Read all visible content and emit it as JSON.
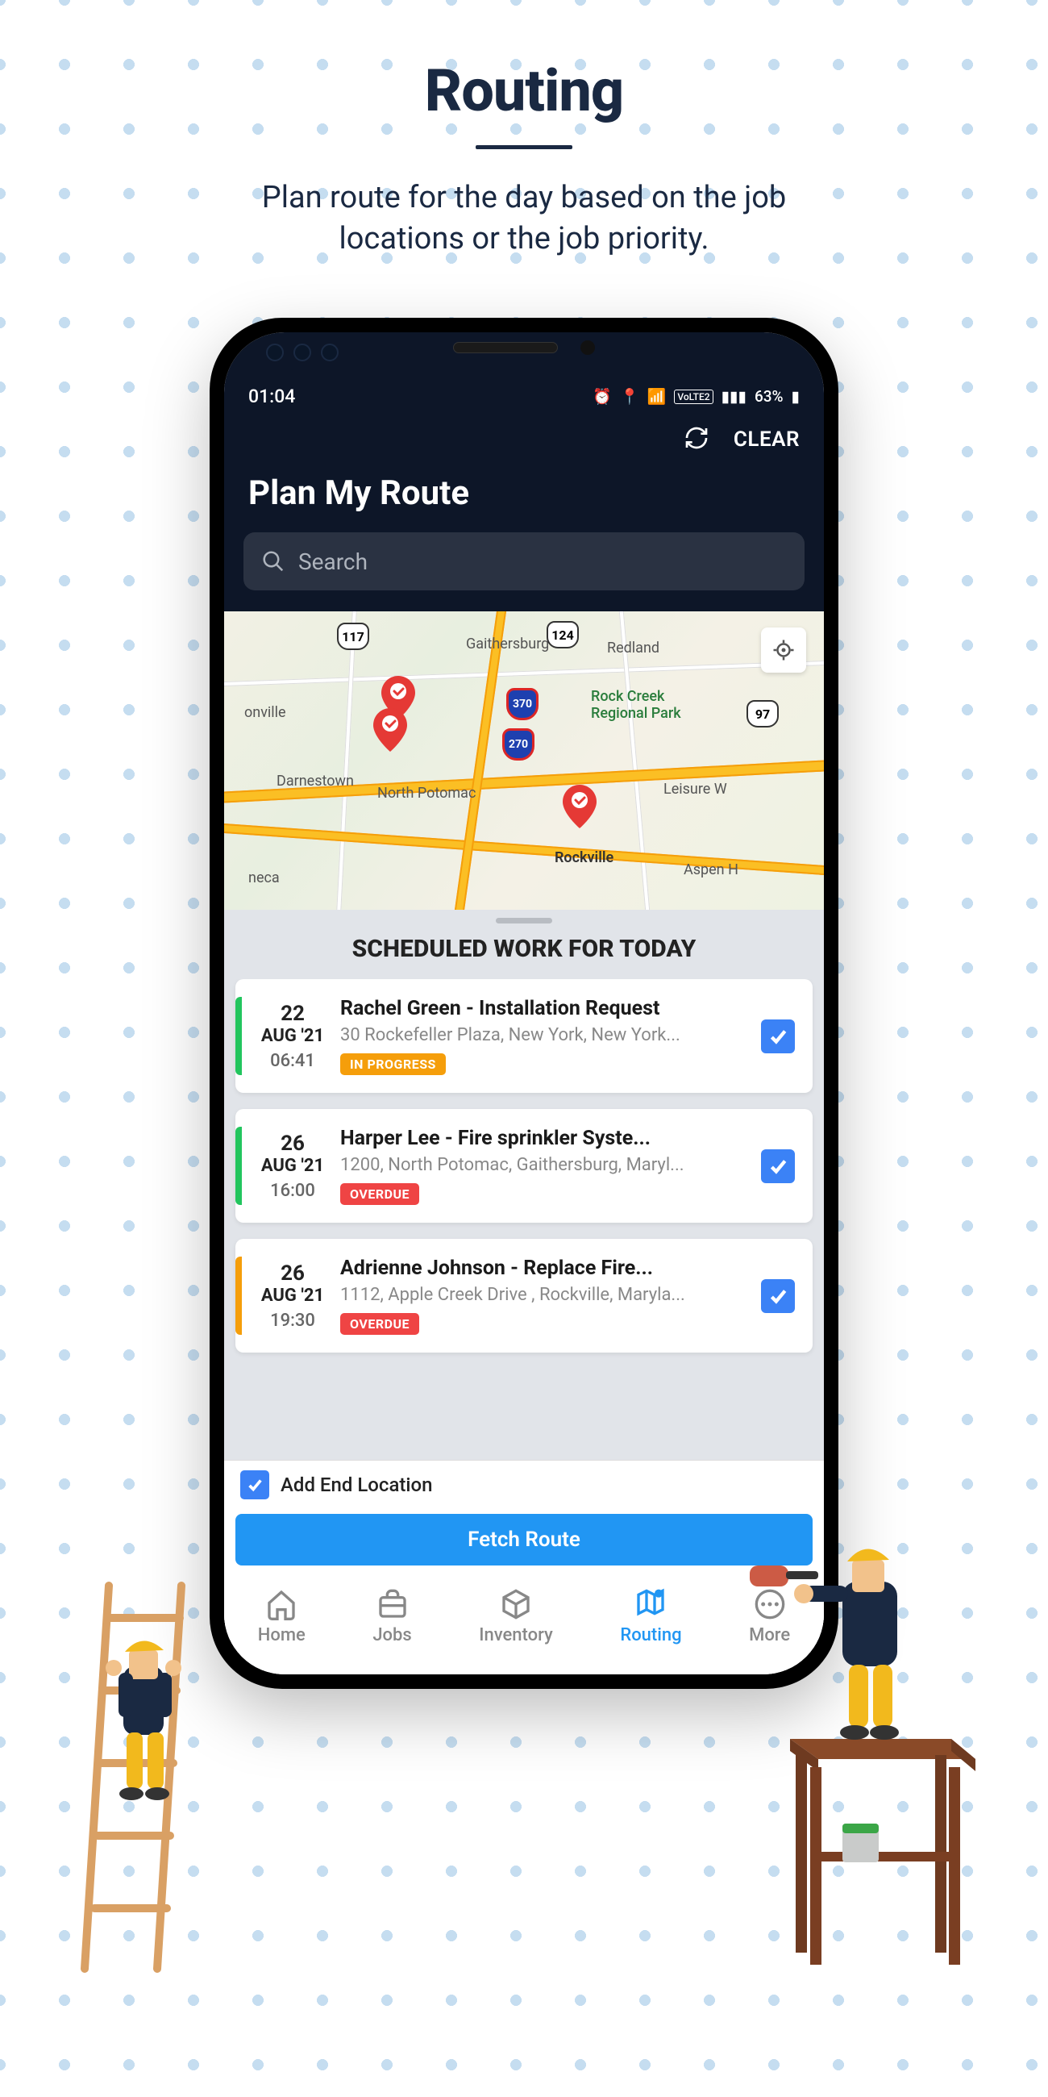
{
  "heading": {
    "title": "Routing",
    "subtitle_line1": "Plan route for the day based on the job",
    "subtitle_line2": "locations or the job priority."
  },
  "statusbar": {
    "time": "01:04",
    "battery": "63%"
  },
  "toolbar": {
    "clear": "CLEAR"
  },
  "screen": {
    "title": "Plan My Route"
  },
  "search": {
    "placeholder": "Search"
  },
  "map": {
    "labels": {
      "gaithersburg": "Gaithersburg",
      "redland": "Redland",
      "rockcreek": "Rock Creek\nRegional Park",
      "darnestown": "Darnestown",
      "northpotomac": "North Potomac",
      "rockville": "Rockville",
      "leisure": "Leisure W",
      "onville": "onville",
      "neca": "neca",
      "aspen": "Aspen H"
    },
    "highways": {
      "h117": "117",
      "h124": "124",
      "h97": "97",
      "i370": "370",
      "i270": "270"
    }
  },
  "work": {
    "section_title": "SCHEDULED WORK FOR TODAY",
    "jobs": [
      {
        "day": "22",
        "month": "AUG '21",
        "time": "06:41",
        "title": "Rachel Green - Installation Request",
        "address": "30 Rockefeller Plaza, New York, New York...",
        "status": "IN PROGRESS",
        "status_style": "s-inprog",
        "strip": "strip-green",
        "checked": true
      },
      {
        "day": "26",
        "month": "AUG '21",
        "time": "16:00",
        "title": "Harper Lee  - Fire sprinkler Syste...",
        "address": "1200, North Potomac, Gaithersburg, Maryl...",
        "status": "OVERDUE",
        "status_style": "s-overdue",
        "strip": "strip-green",
        "checked": true
      },
      {
        "day": "26",
        "month": "AUG '21",
        "time": "19:30",
        "title": "Adrienne  Johnson - Replace Fire...",
        "address": "1112, Apple Creek Drive , Rockville, Maryla...",
        "status": "OVERDUE",
        "status_style": "s-overdue",
        "strip": "strip-amber",
        "checked": true
      }
    ],
    "add_end": "Add End Location",
    "fetch": "Fetch Route"
  },
  "nav": {
    "home": "Home",
    "jobs": "Jobs",
    "inventory": "Inventory",
    "routing": "Routing",
    "more": "More"
  }
}
